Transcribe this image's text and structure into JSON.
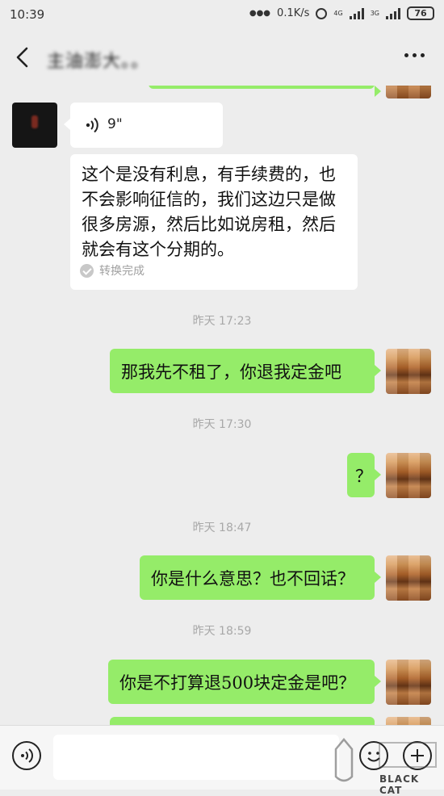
{
  "status_bar": {
    "time": "10:39",
    "network_speed": "0.1K/s",
    "signal_1_label": "4G",
    "signal_2_label": "3G",
    "battery": "76"
  },
  "header": {
    "title": "主油澎大。。",
    "back_icon": "chevron-left-icon",
    "more_icon": "more-dots-icon"
  },
  "messages": {
    "voice": {
      "duration": "9\"",
      "transcript": "这个是没有利息，有手续费的，也不会影响征信的，我们这边只是做很多房源，然后比如说房租，然后就会有这个分期的。",
      "transcript_status": "转换完成"
    },
    "ts1": "昨天 17:23",
    "msg1": "那我先不租了，你退我定金吧",
    "ts2": "昨天 17:30",
    "msg2": "？",
    "ts3": "昨天 18:47",
    "msg3": "你是什么意思？也不回话？",
    "ts4": "昨天 18:59",
    "msg4": "你是不打算退500块定金是吧？"
  },
  "input_bar": {
    "voice_icon": "voice-toggle-icon",
    "emoji_icon": "emoji-icon",
    "plus_icon": "plus-icon",
    "placeholder": ""
  },
  "watermark": "BLACK CAT",
  "colors": {
    "background": "#ededed",
    "sent_bubble": "#95ec69",
    "received_bubble": "#ffffff"
  }
}
